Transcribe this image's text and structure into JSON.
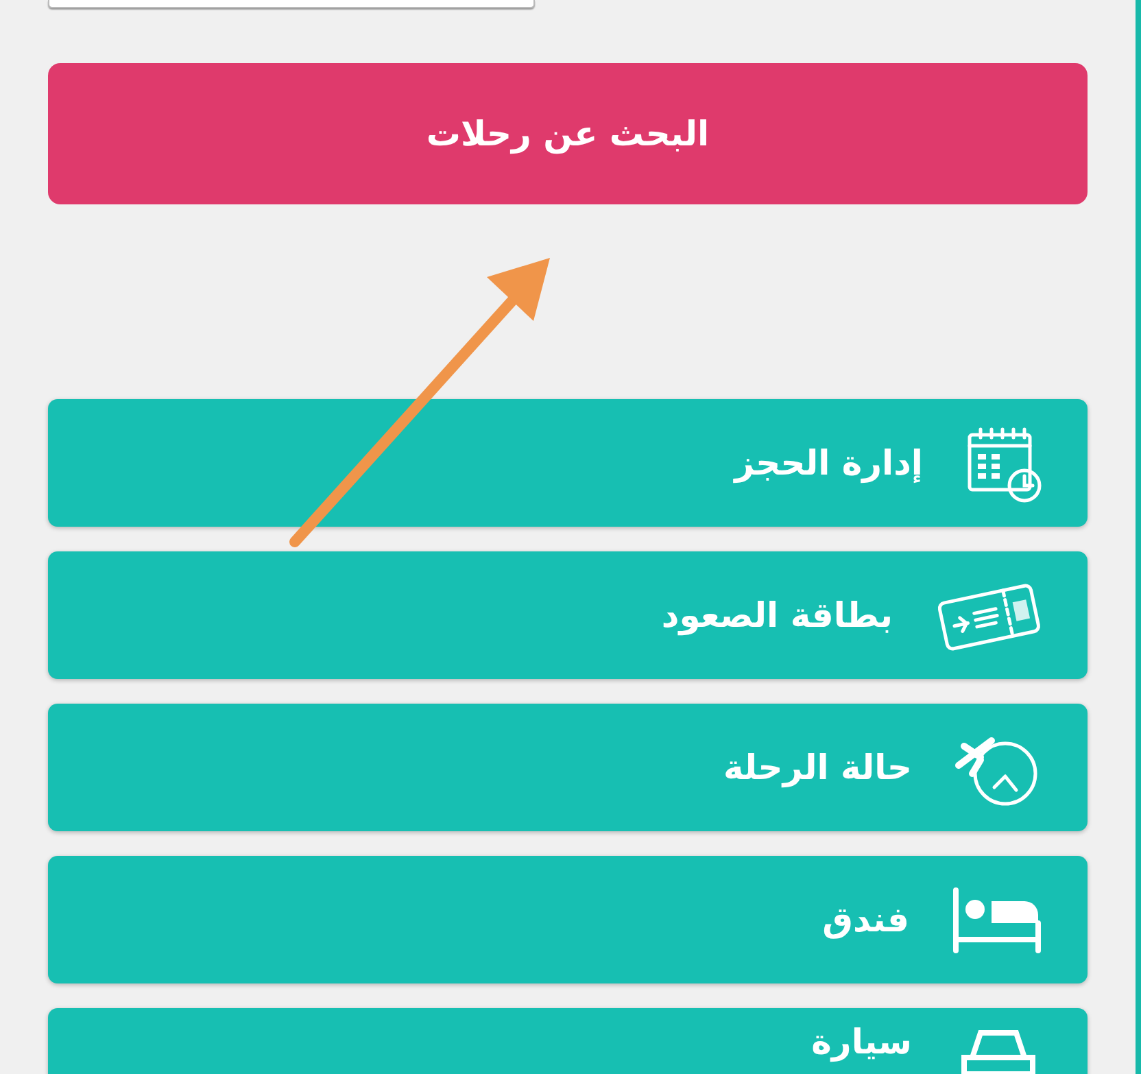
{
  "search_button": {
    "label": "البحث عن رحلات"
  },
  "menu": [
    {
      "label": "إدارة الحجز",
      "kind": "calendar"
    },
    {
      "label": "بطاقة الصعود",
      "kind": "ticket"
    },
    {
      "label": "حالة الرحلة",
      "kind": "flight-clock"
    },
    {
      "label": "فندق",
      "kind": "bed"
    },
    {
      "label": "سيارة",
      "kind": "car"
    }
  ]
}
